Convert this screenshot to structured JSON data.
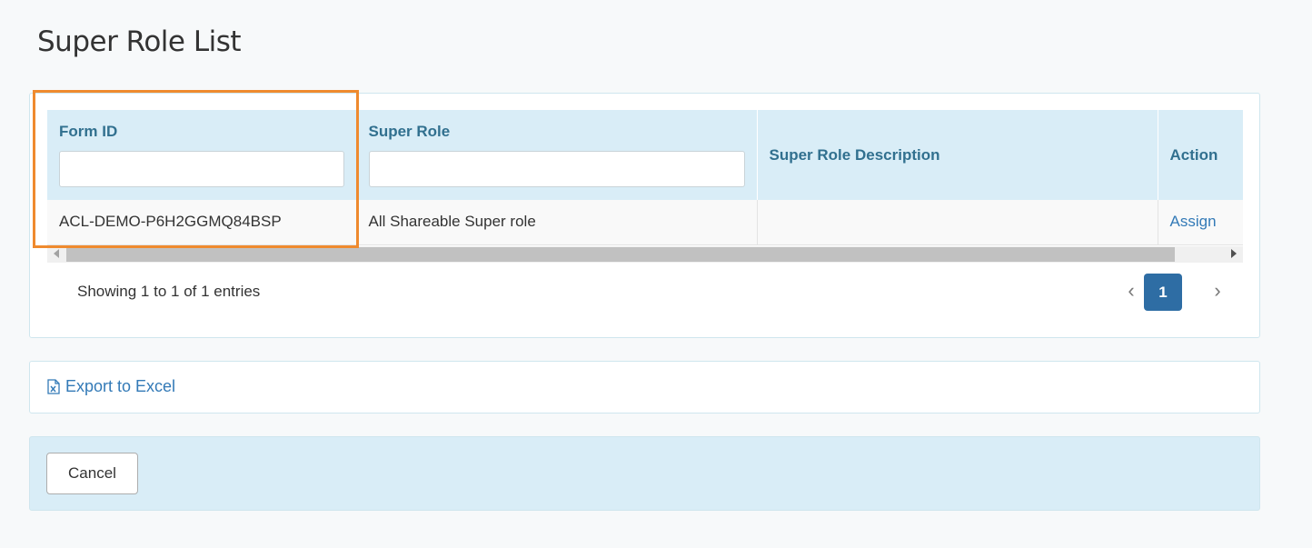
{
  "page": {
    "title": "Super Role List"
  },
  "table": {
    "columns": [
      {
        "label": "Form ID",
        "filter_value": ""
      },
      {
        "label": "Super Role",
        "filter_value": ""
      },
      {
        "label": "Super Role Description"
      },
      {
        "label": "Action"
      }
    ],
    "rows": [
      {
        "form_id": "ACL-DEMO-P6H2GGMQ84BSP",
        "super_role": "All Shareable Super role",
        "description": "",
        "action": "Assign"
      }
    ]
  },
  "pagination": {
    "info": "Showing 1 to 1 of 1 entries",
    "prev_glyph": "‹",
    "current_page": "1",
    "next_glyph": "›"
  },
  "export": {
    "label": "Export to Excel",
    "icon": "file-excel-icon"
  },
  "footer": {
    "cancel_label": "Cancel"
  },
  "colors": {
    "header_bg": "#d9edf7",
    "header_text": "#31708f",
    "link": "#337ab7",
    "primary": "#2e6da4",
    "highlight": "#ef8a2e"
  }
}
